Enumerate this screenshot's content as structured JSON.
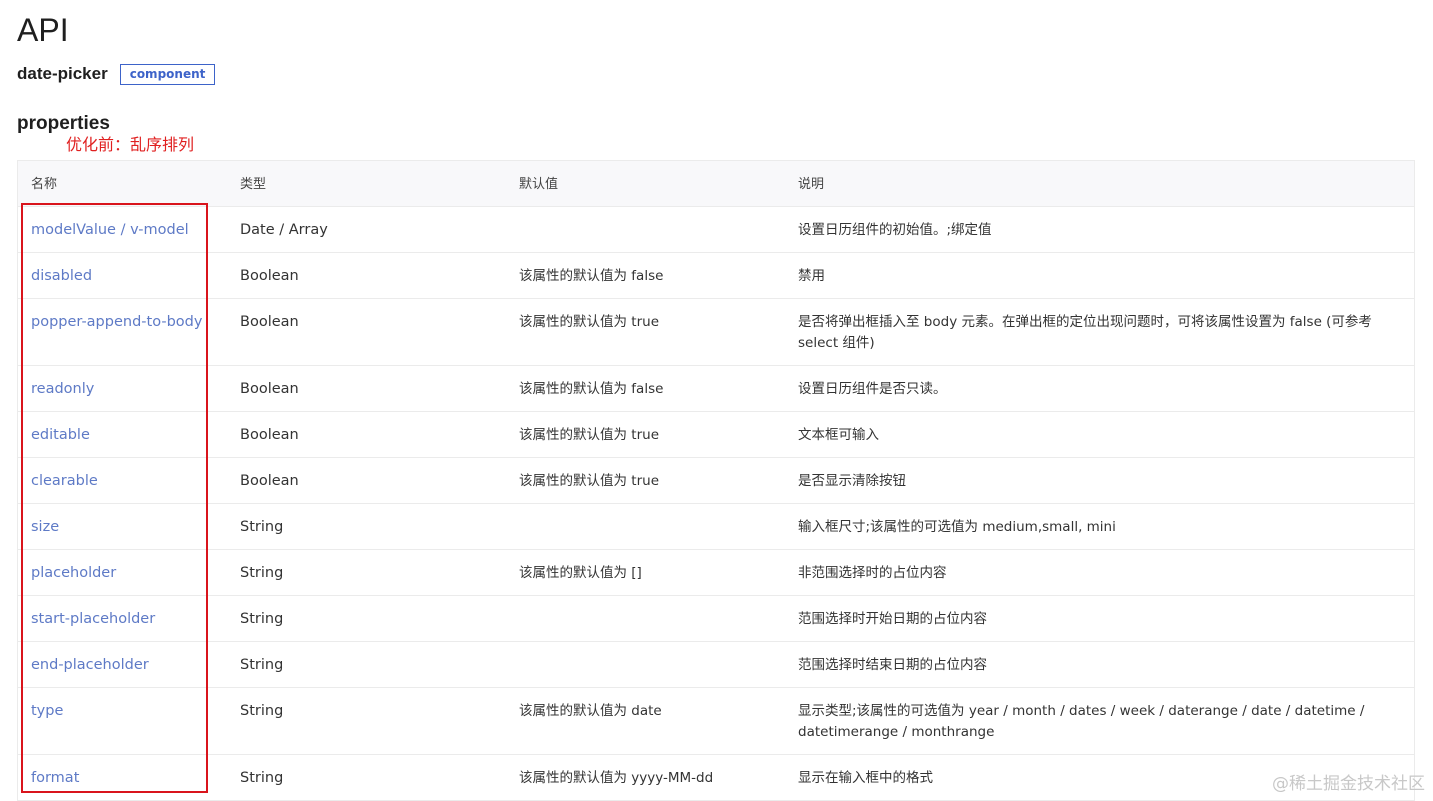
{
  "page": {
    "title": "API",
    "component_name": "date-picker",
    "component_badge": "component",
    "section_title": "properties",
    "annotation": "优化前：乱序排列",
    "watermark": "@稀土掘金技术社区"
  },
  "table": {
    "headers": [
      "名称",
      "类型",
      "默认值",
      "说明"
    ],
    "rows": [
      {
        "name": "modelValue / v-model",
        "type": "Date / Array",
        "default": "",
        "desc": "设置日历组件的初始值。;绑定值"
      },
      {
        "name": "disabled",
        "type": "Boolean",
        "default": "该属性的默认值为 false",
        "desc": "禁用"
      },
      {
        "name": "popper-append-to-body",
        "type": "Boolean",
        "default": "该属性的默认值为 true",
        "desc": "是否将弹出框插入至 body 元素。在弹出框的定位出现问题时，可将该属性设置为 false (可参考 select 组件)"
      },
      {
        "name": "readonly",
        "type": "Boolean",
        "default": "该属性的默认值为 false",
        "desc": "设置日历组件是否只读。"
      },
      {
        "name": "editable",
        "type": "Boolean",
        "default": "该属性的默认值为 true",
        "desc": "文本框可输入"
      },
      {
        "name": "clearable",
        "type": "Boolean",
        "default": "该属性的默认值为 true",
        "desc": "是否显示清除按钮"
      },
      {
        "name": "size",
        "type": "String",
        "default": "",
        "desc": "输入框尺寸;该属性的可选值为 medium,small, mini"
      },
      {
        "name": "placeholder",
        "type": "String",
        "default": "该属性的默认值为 []",
        "desc": "非范围选择时的占位内容"
      },
      {
        "name": "start-placeholder",
        "type": "String",
        "default": "",
        "desc": "范围选择时开始日期的占位内容"
      },
      {
        "name": "end-placeholder",
        "type": "String",
        "default": "",
        "desc": "范围选择时结束日期的占位内容"
      },
      {
        "name": "type",
        "type": "String",
        "default": "该属性的默认值为 date",
        "desc": "显示类型;该属性的可选值为 year / month / dates / week / daterange / date / datetime / datetimerange / monthrange"
      },
      {
        "name": "format",
        "type": "String",
        "default": "该属性的默认值为 yyyy-MM-dd",
        "desc": "显示在输入框中的格式"
      }
    ]
  }
}
